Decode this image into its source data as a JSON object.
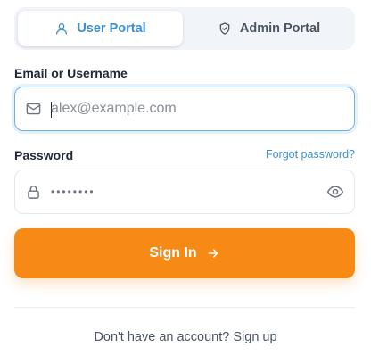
{
  "portal_tabs": [
    {
      "label": "User Portal",
      "icon": "user-icon",
      "active": true
    },
    {
      "label": "Admin Portal",
      "icon": "shield-check-icon",
      "active": false
    }
  ],
  "email": {
    "label": "Email or Username",
    "placeholder": "alex@example.com",
    "value": "",
    "icon": "mail-icon"
  },
  "password": {
    "label": "Password",
    "masked_value": "••••••••",
    "icon": "lock-icon",
    "toggle_icon": "eye-icon"
  },
  "forgot_password": "Forgot password?",
  "sign_in": {
    "label": "Sign In",
    "icon": "arrow-right-icon"
  },
  "footer": {
    "prompt": "Don't have an account?",
    "link": "Sign up"
  },
  "colors": {
    "accent_blue": "#3b8fd0",
    "primary_orange": "#f68a14",
    "tab_background": "#f1f4f8",
    "focus_border": "#6fb2dd"
  }
}
